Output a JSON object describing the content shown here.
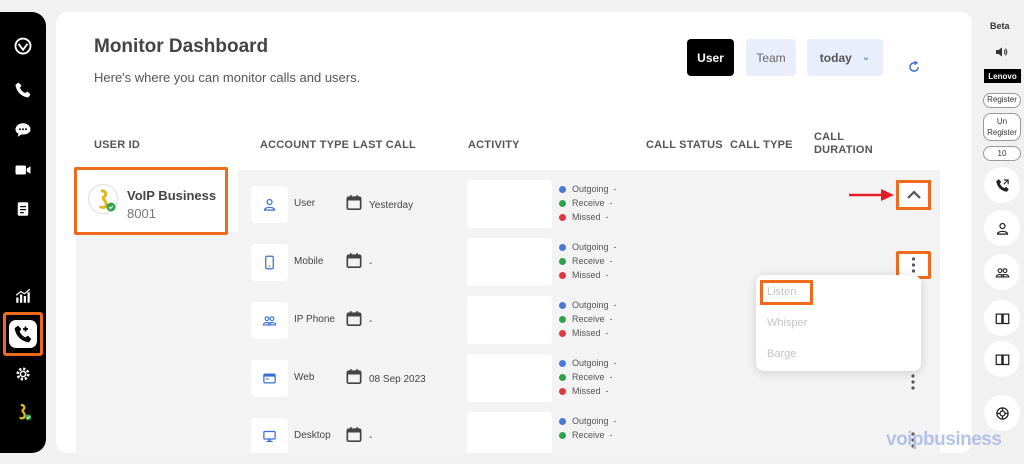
{
  "header": {
    "title": "Monitor Dashboard",
    "subtitle": "Here's where you can monitor calls and users.",
    "toggle_user": "User",
    "toggle_team": "Team",
    "period": "today"
  },
  "table": {
    "columns": [
      "USER ID",
      "ACCOUNT TYPE",
      "LAST CALL",
      "ACTIVITY",
      "CALL STATUS",
      "CALL TYPE",
      "CALL DURATION"
    ],
    "user": {
      "name": "VoIP Business",
      "extension": "8001"
    },
    "rows": [
      {
        "account_type": "User",
        "last_call": "Yesterday"
      },
      {
        "account_type": "Mobile",
        "last_call": "-"
      },
      {
        "account_type": "IP Phone",
        "last_call": "-"
      },
      {
        "account_type": "Web",
        "last_call": "08 Sep 2023"
      },
      {
        "account_type": "Desktop",
        "last_call": "-"
      }
    ],
    "legend": {
      "outgoing": "Outgoing",
      "receive": "Receive",
      "missed": "Missed",
      "value": "-"
    }
  },
  "menu": {
    "listen": "Listen",
    "whisper": "Whisper",
    "barge": "Barge"
  },
  "right_bar": {
    "beta": "Beta",
    "brand": "Lenovo",
    "register": "Register",
    "unregister": "Un Register",
    "count": "10"
  },
  "watermark": "voipbusiness",
  "colors": {
    "accent": "#f06a1b",
    "outgoing": "#4a78d8",
    "receive": "#2fa34a",
    "missed": "#e0383e",
    "toggle_bg": "#e8eefb"
  }
}
